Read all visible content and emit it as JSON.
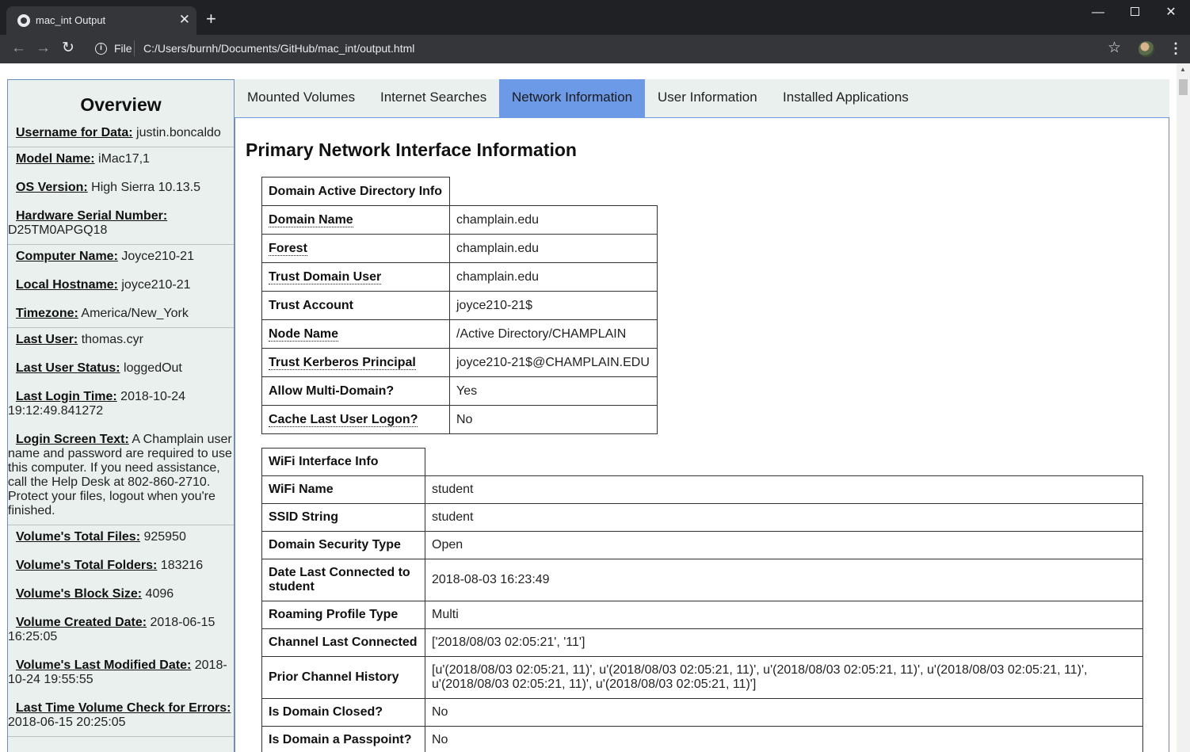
{
  "browser": {
    "tab_title": "mac_int Output",
    "tab_close": "✕",
    "new_tab": "+",
    "scheme": "File",
    "url": "C:/Users/burnh/Documents/GitHub/mac_int/output.html",
    "minimize": "—",
    "close": "✕"
  },
  "sidebar": {
    "title": "Overview",
    "groups": [
      [
        {
          "key": "Username for Data:",
          "value": " justin.boncaldo"
        }
      ],
      [
        {
          "key": "Model Name:",
          "value": " iMac17,1"
        },
        {
          "key": "OS Version:",
          "value": " High Sierra 10.13.5"
        },
        {
          "key": "Hardware Serial Number:",
          "value": " D25TM0APGQ18"
        }
      ],
      [
        {
          "key": "Computer Name:",
          "value": " Joyce210-21"
        },
        {
          "key": "Local Hostname:",
          "value": " joyce210-21"
        },
        {
          "key": "Timezone:",
          "value": " America/New_York"
        }
      ],
      [
        {
          "key": "Last User:",
          "value": " thomas.cyr"
        },
        {
          "key": "Last User Status:",
          "value": " loggedOut"
        },
        {
          "key": "Last Login Time:",
          "value": " 2018-10-24 19:12:49.841272"
        },
        {
          "key": "Login Screen Text:",
          "value": " A Champlain user name and password are required to use this computer. If you need assistance, call the Help Desk at 802-860-2710. Protect your files, logout when you're finished."
        }
      ],
      [
        {
          "key": "Volume's Total Files:",
          "value": " 925950"
        },
        {
          "key": "Volume's Total Folders:",
          "value": " 183216"
        },
        {
          "key": "Volume's Block Size:",
          "value": " 4096"
        },
        {
          "key": "Volume Created Date:",
          "value": " 2018-06-15 16:25:05"
        },
        {
          "key": "Volume's Last Modified Date:",
          "value": " 2018-10-24 19:55:55"
        },
        {
          "key": "Last Time Volume Check for Errors:",
          "value": " 2018-06-15 20:25:05"
        }
      ]
    ]
  },
  "tabs": [
    {
      "label": "Mounted Volumes",
      "active": false
    },
    {
      "label": "Internet Searches",
      "active": false
    },
    {
      "label": "Network Information",
      "active": true
    },
    {
      "label": "User Information",
      "active": false
    },
    {
      "label": "Installed Applications",
      "active": false
    }
  ],
  "main": {
    "heading": "Primary Network Interface Information",
    "ad_table": {
      "header": "Domain Active Directory Info",
      "rows": [
        {
          "key": "Domain Name",
          "value": "champlain.edu",
          "abbr": true
        },
        {
          "key": "Forest",
          "value": "champlain.edu",
          "abbr": true
        },
        {
          "key": "Trust Domain User",
          "value": "champlain.edu",
          "abbr": true
        },
        {
          "key": "Trust Account",
          "value": "joyce210-21$",
          "abbr": false
        },
        {
          "key": "Node Name",
          "value": "/Active Directory/CHAMPLAIN",
          "abbr": true
        },
        {
          "key": "Trust Kerberos Principal",
          "value": "joyce210-21$@CHAMPLAIN.EDU",
          "abbr": true
        },
        {
          "key": "Allow Multi-Domain?",
          "value": "Yes",
          "abbr": false
        },
        {
          "key": "Cache Last User Logon?",
          "value": "No",
          "abbr": true
        }
      ]
    },
    "wifi_table": {
      "header": "WiFi Interface Info",
      "rows": [
        {
          "key": "WiFi Name",
          "value": "student",
          "tall": false
        },
        {
          "key": "SSID String",
          "value": "student",
          "tall": false
        },
        {
          "key": "Domain Security Type",
          "value": "Open",
          "tall": false
        },
        {
          "key": "Date Last Connected to student",
          "value": "2018-08-03 16:23:49",
          "tall": true
        },
        {
          "key": "Roaming Profile Type",
          "value": "Multi",
          "tall": false
        },
        {
          "key": "Channel Last Connected",
          "value": "['2018/08/03 02:05:21', '11']",
          "tall": false
        },
        {
          "key": "Prior Channel History",
          "value": "[u'(2018/08/03 02:05:21, 11)', u'(2018/08/03 02:05:21, 11)', u'(2018/08/03 02:05:21, 11)', u'(2018/08/03 02:05:21, 11)', u'(2018/08/03 02:05:21, 11)', u'(2018/08/03 02:05:21, 11)']",
          "tall": true
        },
        {
          "key": "Is Domain Closed?",
          "value": "No",
          "tall": false
        },
        {
          "key": "Is Domain a Passpoint?",
          "value": "No",
          "tall": false
        }
      ]
    }
  }
}
